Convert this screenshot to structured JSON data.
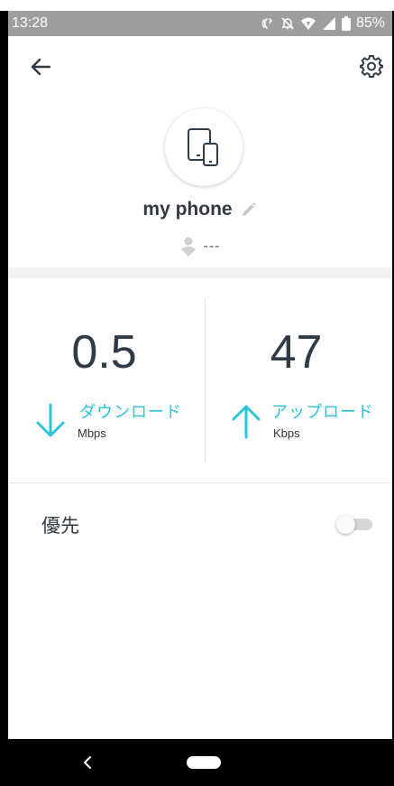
{
  "status_bar": {
    "time": "13:28",
    "battery": "85%",
    "icons": [
      "nfc-icon",
      "bell-off-icon",
      "wifi-icon",
      "signal-icon",
      "battery-icon"
    ]
  },
  "app_bar": {
    "back_icon": "arrow-left-icon",
    "settings_icon": "gear-icon"
  },
  "device": {
    "icon": "tablet-phone-icon",
    "name": "my phone",
    "edit_icon": "pencil-icon",
    "owner_icon": "person-icon",
    "owner": "---"
  },
  "speed": {
    "download": {
      "value": "0.5",
      "label": "ダウンロード",
      "unit": "Mbps",
      "icon": "arrow-down-icon"
    },
    "upload": {
      "value": "47",
      "label": "アップロード",
      "unit": "Kbps",
      "icon": "arrow-up-icon"
    }
  },
  "priority": {
    "label": "優先",
    "enabled": false
  },
  "colors": {
    "accent": "#2fc3d6",
    "text_dark": "#2f3b47",
    "status_bar": "#9e9e9e"
  },
  "nav_bar": {
    "back_icon": "nav-back-icon",
    "home_icon": "nav-home-pill"
  }
}
